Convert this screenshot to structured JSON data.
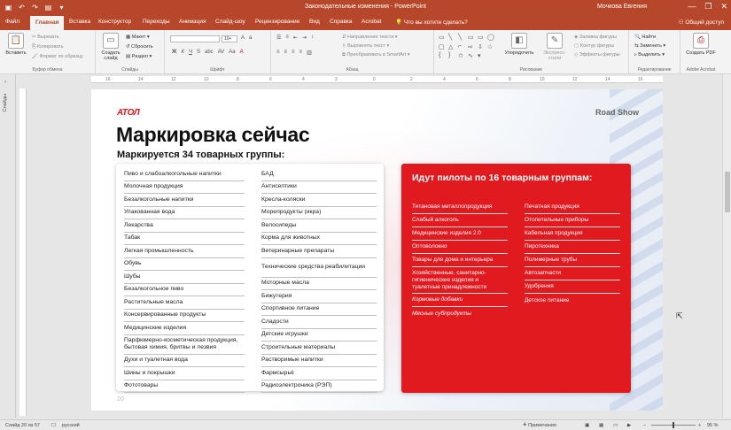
{
  "window": {
    "title": "Законодательные изменения - PowerPoint",
    "user": "Мочкова Евгения",
    "controls": [
      "—",
      "❐",
      "✕"
    ]
  },
  "tabs": [
    {
      "label": "Файл",
      "active": false
    },
    {
      "label": "Главная",
      "active": true
    },
    {
      "label": "Вставка",
      "active": false
    },
    {
      "label": "Конструктор",
      "active": false
    },
    {
      "label": "Переходы",
      "active": false
    },
    {
      "label": "Анимация",
      "active": false
    },
    {
      "label": "Слайд-шоу",
      "active": false
    },
    {
      "label": "Рецензирование",
      "active": false
    },
    {
      "label": "Вид",
      "active": false
    },
    {
      "label": "Справка",
      "active": false
    },
    {
      "label": "Acrobat",
      "active": false
    }
  ],
  "tell_me": "Что вы хотите сделать?",
  "share": "Общий доступ",
  "ribbon": {
    "clipboard": {
      "paste": "Вставить",
      "cut": "Вырезать",
      "copy": "Копировать",
      "format_painter": "Формат по образцу",
      "label": "Буфер обмена"
    },
    "slides": {
      "new_slide": "Создать слайд",
      "layout": "Макет",
      "reset": "Сбросить",
      "section": "Раздел",
      "label": "Слайды"
    },
    "font": {
      "label": "Шрифт",
      "size": "10+"
    },
    "paragraph": {
      "direction": "Направление текста",
      "align": "Выровнять текст",
      "smartart": "Преобразовать в SmartArt",
      "label": "Абзац"
    },
    "drawing": {
      "arrange": "Упорядочить",
      "quick_styles": "Экспресс-стили",
      "fill": "Заливка фигуры",
      "outline": "Контур фигуры",
      "effects": "Эффекты фигуры",
      "label": "Рисование"
    },
    "editing": {
      "find": "Найти",
      "replace": "Заменить",
      "select": "Выделить",
      "label": "Редактирование"
    },
    "acrobat": {
      "create_pdf": "Создать PDF",
      "label": "Adobe Acrobat"
    }
  },
  "left_panel": {
    "label": "Слайды"
  },
  "ruler": [
    "16",
    "14",
    "12",
    "10",
    "8",
    "6",
    "4",
    "2",
    "0",
    "2",
    "4",
    "6",
    "8",
    "10",
    "12",
    "14",
    "16"
  ],
  "slide": {
    "logo": "АТОЛ",
    "roadshow": "Road Show",
    "title": "Маркировка сейчас",
    "subtitle": "Маркируется 34 товарных группы:",
    "left_col1": [
      "Пиво и слабоалкогольные напитки",
      "Молочная продукция",
      "Безалкогольные напитки",
      "Упакованная вода",
      "Лекарства",
      "Табак",
      "Легкая промышленность",
      "Обувь",
      "Шубы",
      "Безалкогольное пиво",
      "Растительные масла",
      "Консервированные продукты",
      "Медицинские изделия",
      "Парфюмерно-косметическая продукция, бытовая химия, бритвы и лезвия",
      "Духи и туалетная вода",
      "Шины и покрышки",
      "Фототовары"
    ],
    "left_col2": [
      "БАД",
      "Антисептики",
      "Кресла-коляски",
      "Морепродукты (икра)",
      "Велосипеды",
      "Корма для животных",
      "Ветеринарные препараты",
      "Технические средства реабилитации",
      "Моторные масла",
      "Бижутерия",
      "Спортивное питание",
      "Сладости",
      "Детские игрушки",
      "Строительные материалы",
      "Растворимые напитки",
      "Фармсырьё",
      "Радиоэлектроника (РЭП)"
    ],
    "right_title": "Идут пилоты по 16 товарным группам:",
    "right_col1": [
      "Титановая металлопродукция",
      "Слабый алкоголь",
      "Медицинские изделия 2.0",
      "Оптоволокно",
      "Товары для дома и интерьера",
      "Хозяйственные, санитарно-гигиенические изделия и туалетные принадлежности",
      "Кормовые добавки",
      "Мясные субпродукты"
    ],
    "right_col2": [
      "Печатная продукция",
      "Отопительные приборы",
      "Кабельная продукция",
      "Пиротехника",
      "Полимерные трубы",
      "Автозапчасти",
      "Удобрения",
      "Детское питание"
    ],
    "page_number": "20"
  },
  "status": {
    "slide": "Слайд 20 из 57",
    "language": "русский",
    "notes": "Примечания",
    "zoom": "95 %"
  },
  "colors": {
    "accent": "#b7472a",
    "brand_red": "#e11a20"
  }
}
